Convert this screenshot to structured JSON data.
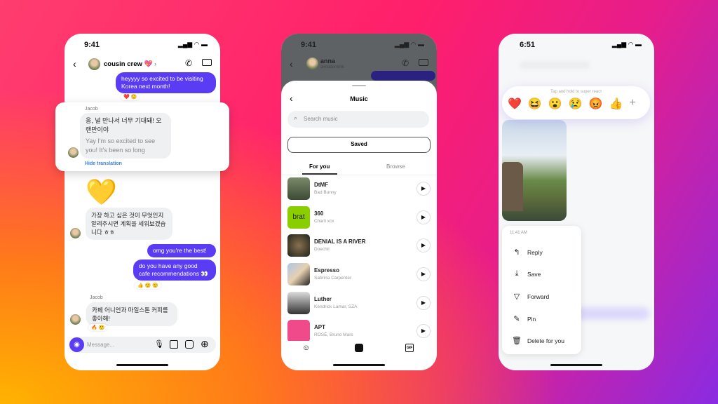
{
  "colors": {
    "accent": "#5b3cf5",
    "link": "#3b82e0"
  },
  "phone1": {
    "time": "9:41",
    "chat_name": "cousin crew",
    "msg1": "heyyyy so excited to be visiting Korea next month!",
    "msg1_reacts": "❤️ 🙂",
    "sender": "Jacob",
    "korean1": "응, 널 만나서 너무 기대돼! 오랜만이야",
    "translation": "Yay I'm so excited to see you! It's been so long",
    "hide_translation": "Hide translation",
    "korean2": "가장 하고 싶은 것이 무엇인지 알려주시면 계획을 세워보겠습니다 ㅎㅎ",
    "msg2": "omg you're the best!",
    "msg3": "do you have any good cafe recommendations 👀",
    "msg3_reacts": "👍 🙂 🙂",
    "sender2": "Jacob",
    "korean3": "카페 어니언과 마일스톤 커피를 좋아해!",
    "korean3_reacts": "🔥 🙂",
    "message_placeholder": "Message..."
  },
  "phone2": {
    "time": "9:41",
    "chat_name": "anna",
    "chat_username": "annadominik",
    "sheet_title": "Music",
    "search_placeholder": "Search music",
    "saved_label": "Saved",
    "tabs": [
      "For you",
      "Browse"
    ],
    "active_tab": "For you",
    "songs": [
      {
        "title": "DtMF",
        "artist": "Bad Bunny"
      },
      {
        "title": "360",
        "artist": "Charli xcx",
        "cover_text": "brat"
      },
      {
        "title": "DENIAL IS A RIVER",
        "artist": "Doechii"
      },
      {
        "title": "Espresso",
        "artist": "Sabrina Carpenter"
      },
      {
        "title": "Luther",
        "artist": "Kendrick Lamar, SZA"
      },
      {
        "title": "APT",
        "artist": "ROSÉ, Bruno Mars"
      }
    ],
    "gif_label": "GIF"
  },
  "phone3": {
    "time": "6:51",
    "react_hint": "Tap and hold to super react",
    "emojis": [
      "❤️",
      "😆",
      "😮",
      "😢",
      "😡",
      "👍"
    ],
    "timestamp": "11:41 AM",
    "menu": [
      "Reply",
      "Save",
      "Forward",
      "Pin",
      "Delete for you"
    ]
  }
}
